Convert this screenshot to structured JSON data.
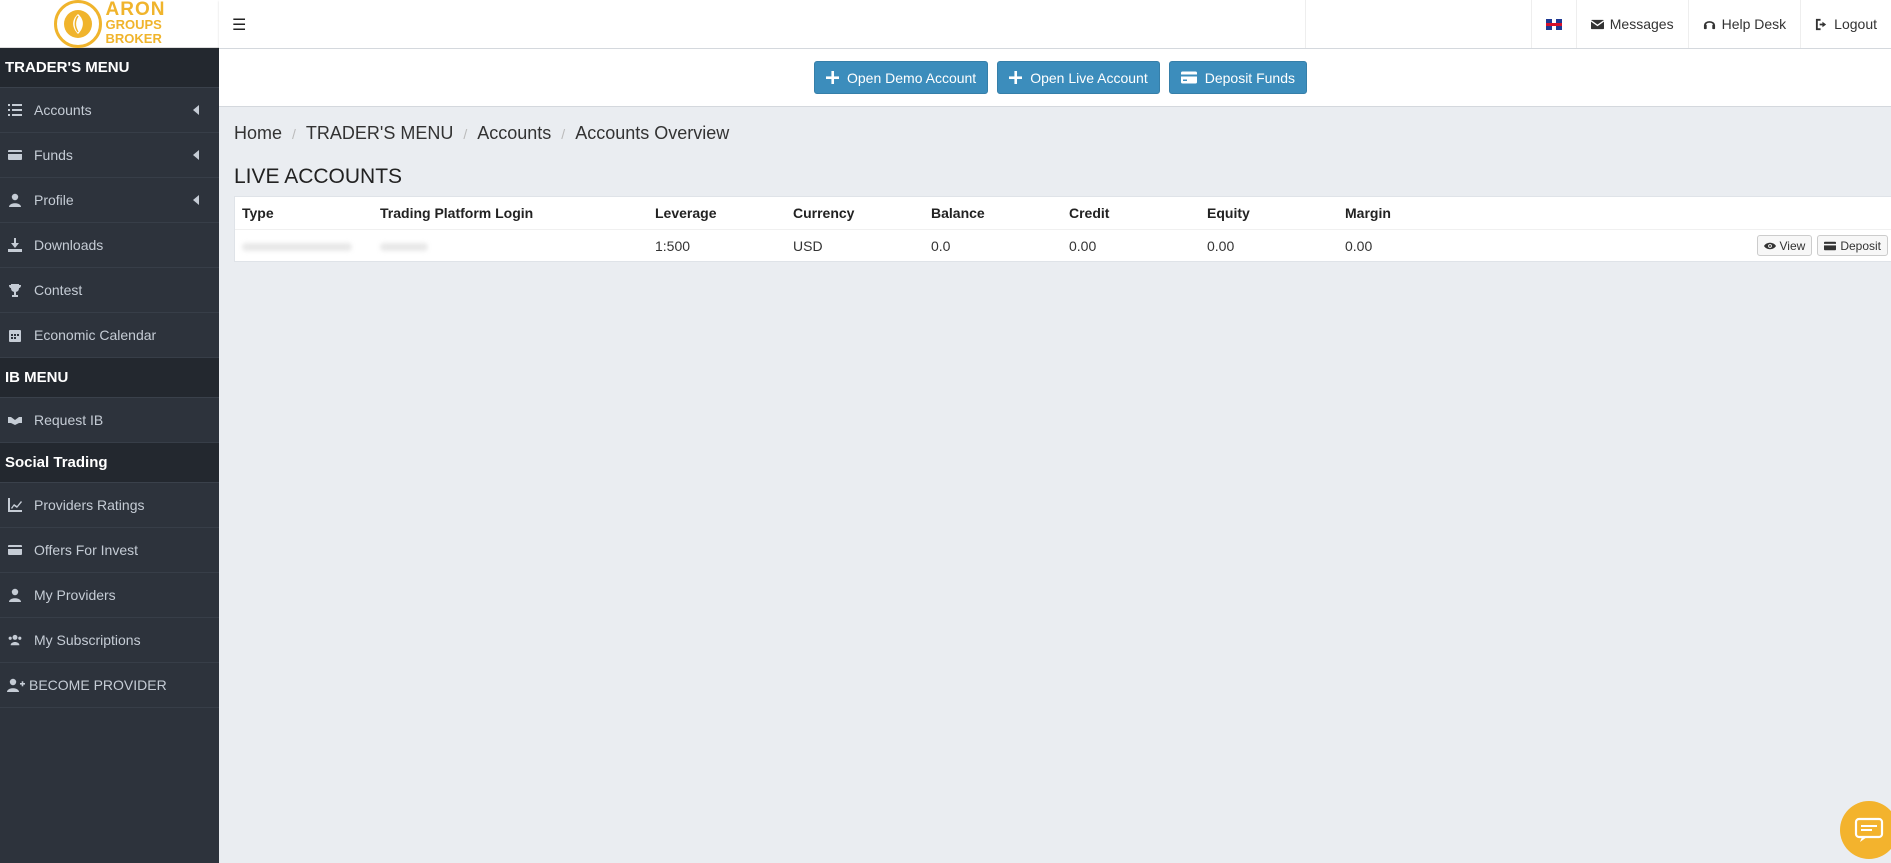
{
  "brand": {
    "line1": "ARON",
    "line2": "GROUPS",
    "line3": "BROKER",
    "accent": "#f0b42c"
  },
  "sidebar": {
    "sections": [
      {
        "title": "TRADER'S MENU",
        "items": [
          {
            "label": "Accounts",
            "icon": "list-icon",
            "expandable": true
          },
          {
            "label": "Funds",
            "icon": "wallet-icon",
            "expandable": true
          },
          {
            "label": "Profile",
            "icon": "user-icon",
            "expandable": true
          },
          {
            "label": "Downloads",
            "icon": "download-icon",
            "expandable": false
          },
          {
            "label": "Contest",
            "icon": "trophy-icon",
            "expandable": false
          },
          {
            "label": "Economic Calendar",
            "icon": "calendar-icon",
            "expandable": false
          }
        ]
      },
      {
        "title": "IB MENU",
        "items": [
          {
            "label": "Request IB",
            "icon": "handshake-icon",
            "expandable": false
          }
        ]
      },
      {
        "title": "Social Trading",
        "items": [
          {
            "label": "Providers Ratings",
            "icon": "chart-line-icon",
            "expandable": false
          },
          {
            "label": "Offers For Invest",
            "icon": "wallet-icon",
            "expandable": false
          },
          {
            "label": "My Providers",
            "icon": "user-icon",
            "expandable": false
          },
          {
            "label": "My Subscriptions",
            "icon": "users-icon",
            "expandable": false
          },
          {
            "label": "BECOME PROVIDER",
            "icon": "user-plus-icon",
            "expandable": false
          }
        ]
      }
    ]
  },
  "topbar": {
    "messages": "Messages",
    "helpdesk": "Help Desk",
    "logout": "Logout",
    "language_icon": "uk-flag-icon"
  },
  "actions": {
    "open_demo": "Open Demo Account",
    "open_live": "Open Live Account",
    "deposit_funds": "Deposit Funds",
    "color": "#3c8dbc"
  },
  "breadcrumb": [
    "Home",
    "TRADER'S MENU",
    "Accounts",
    "Accounts Overview"
  ],
  "page_title": "LIVE ACCOUNTS",
  "table": {
    "headers": [
      "Type",
      "Trading Platform Login",
      "Leverage",
      "Currency",
      "Balance",
      "Credit",
      "Equity",
      "Margin"
    ],
    "rows": [
      {
        "leverage": "1:500",
        "currency": "USD",
        "balance": "0.0",
        "credit": "0.00",
        "equity": "0.00",
        "margin": "0.00",
        "view": "View",
        "deposit": "Deposit"
      }
    ]
  }
}
